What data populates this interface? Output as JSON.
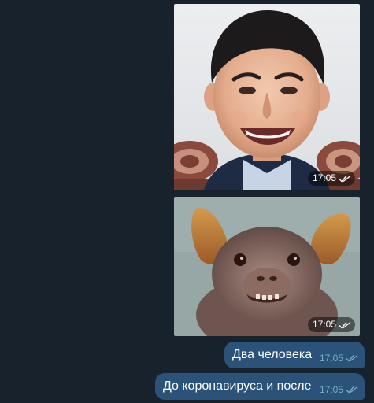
{
  "messages": [
    {
      "type": "photo",
      "alt": "",
      "time": "17:05",
      "status": "read"
    },
    {
      "type": "photo",
      "alt": "",
      "time": "17:05",
      "status": "read"
    },
    {
      "type": "text",
      "text": "Два человека",
      "time": "17:05",
      "status": "read"
    },
    {
      "type": "text",
      "text": "До коронавируса и после",
      "time": "17:05",
      "status": "read"
    }
  ],
  "colors": {
    "background": "#18222d",
    "outgoing_bubble": "#2b5278",
    "meta_text": "#7da8d3",
    "tick_color": "#7da8d3"
  },
  "icons": {
    "read_status": "double-check-icon"
  }
}
